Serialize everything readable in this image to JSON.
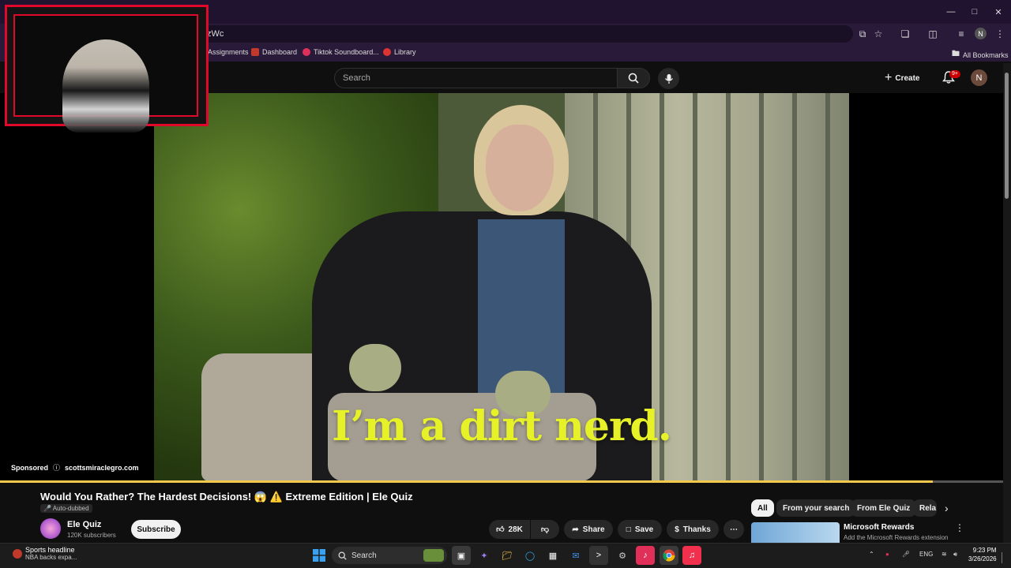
{
  "browser": {
    "url_fragment": "zWc",
    "bookmarks": [
      "Assignments",
      "Dashboard",
      "Tiktok Soundboard...",
      "Library"
    ],
    "all_bookmarks": "All Bookmarks",
    "profile_initial": "N"
  },
  "youtube": {
    "search_placeholder": "Search",
    "create_label": "Create",
    "notif_badge": "9+",
    "account_initial": "N"
  },
  "video": {
    "caption": "I’m a dirt nerd.",
    "sponsored_label": "Sponsored",
    "advertiser": "scottsmiraclegro.com",
    "progress_fraction": 0.93
  },
  "details": {
    "title": "Would You Rather? The Hardest Decisions! 😱 ⚠️ Extreme Edition | Ele Quiz",
    "auto_dubbed": "Auto-dubbed",
    "channel_name": "Ele Quiz",
    "subscribers": "120K subscribers",
    "subscribe_label": "Subscribe",
    "likes": "28K",
    "share_label": "Share",
    "save_label": "Save",
    "thanks_label": "Thanks"
  },
  "chips": [
    "All",
    "From your search",
    "From Ele Quiz",
    "Rela"
  ],
  "ad_card": {
    "title": "Microsoft Rewards",
    "subtitle": "Add the Microsoft Rewards extension"
  },
  "taskbar": {
    "news_title": "Sports headline",
    "news_sub": "NBA backs expa...",
    "search_label": "Search",
    "language": "ENG",
    "time": "9:23 PM",
    "date": "3/26/2026"
  }
}
